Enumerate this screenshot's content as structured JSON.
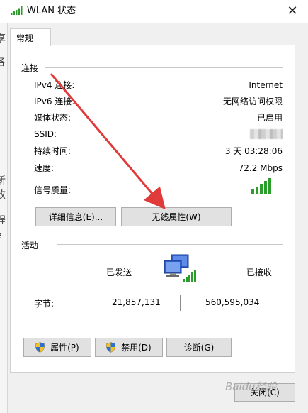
{
  "window": {
    "title": "WLAN 状态",
    "close_glyph": "✕"
  },
  "tabs": [
    {
      "label": "常规",
      "selected": true
    }
  ],
  "connection": {
    "section_title": "连接",
    "rows": [
      {
        "label": "IPv4 连接:",
        "value": "Internet"
      },
      {
        "label": "IPv6 连接:",
        "value": "无网络访问权限"
      },
      {
        "label": "媒体状态:",
        "value": "已启用"
      },
      {
        "label": "SSID:",
        "value": ""
      },
      {
        "label": "持续时间:",
        "value": "3 天 03:28:06"
      },
      {
        "label": "速度:",
        "value": "72.2 Mbps"
      },
      {
        "label": "信号质量:",
        "value": ""
      }
    ],
    "signal_bars_filled": 5,
    "signal_bars_total": 5,
    "buttons": {
      "details": "详细信息(E)...",
      "wireless_properties": "无线属性(W)"
    }
  },
  "activity": {
    "section_title": "活动",
    "sent_label": "已发送",
    "received_label": "已接收",
    "bytes_label": "字节:",
    "bytes_sent": "21,857,131",
    "bytes_received": "560,595,034"
  },
  "bottom_buttons": {
    "properties": "属性(P)",
    "disable": "禁用(D)",
    "diagnose": "诊断(G)"
  },
  "close_button": "关闭(C)",
  "watermark": "Baidu经验",
  "colors": {
    "accent_green": "#2a9d2a",
    "arrow_red": "#e03a3a",
    "window_bg": "#f0f0f0",
    "panel_bg": "#ffffff"
  },
  "icons": {
    "title": "wifi-signal-icon",
    "network": "network-computers-icon",
    "shield": "uac-shield-icon"
  }
}
